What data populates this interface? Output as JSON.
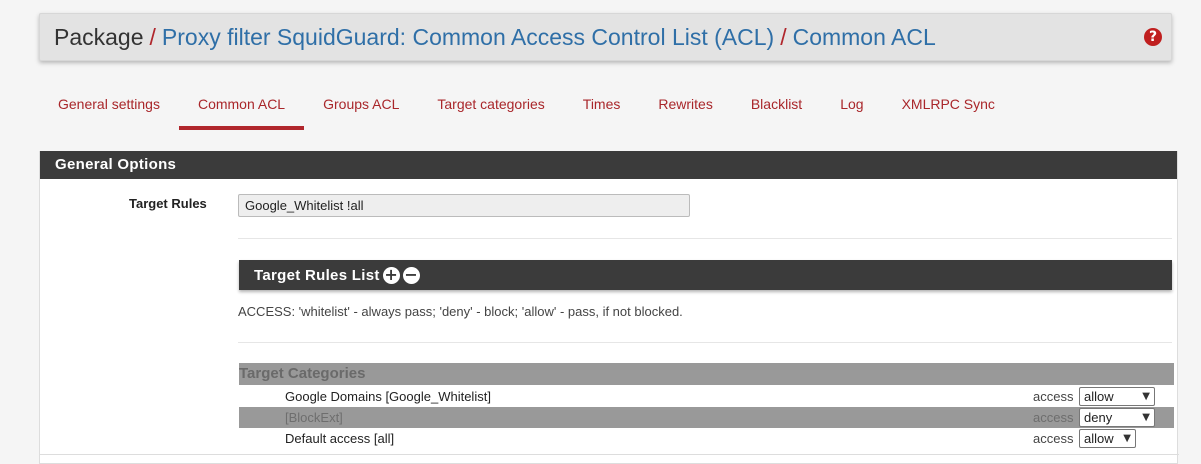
{
  "breadcrumb": {
    "root": "Package",
    "sep": "/",
    "items": [
      "Proxy filter SquidGuard: Common Access Control List (ACL)",
      "Common ACL"
    ]
  },
  "help_icon": "question-circle-icon",
  "tabs": [
    {
      "label": "General settings",
      "active": false
    },
    {
      "label": "Common ACL",
      "active": true
    },
    {
      "label": "Groups ACL",
      "active": false
    },
    {
      "label": "Target categories",
      "active": false
    },
    {
      "label": "Times",
      "active": false
    },
    {
      "label": "Rewrites",
      "active": false
    },
    {
      "label": "Blacklist",
      "active": false
    },
    {
      "label": "Log",
      "active": false
    },
    {
      "label": "XMLRPC Sync",
      "active": false
    }
  ],
  "panel": {
    "title": "General Options",
    "target_rules_label": "Target Rules",
    "target_rules_value": "Google_Whitelist !all",
    "rules_list_title": "Target Rules List",
    "add_icon": "plus-circle-icon",
    "remove_icon": "minus-circle-icon",
    "access_note": "ACCESS: 'whitelist' - always pass; 'deny' - block; 'allow' - pass, if not blocked.",
    "categories_title": "Target Categories",
    "categories": [
      {
        "name": "Google Domains [Google_Whitelist]",
        "access_label": "access",
        "value": "allow"
      },
      {
        "name": "[BlockExt]",
        "access_label": "access",
        "value": "deny"
      },
      {
        "name": "Default access [all]",
        "access_label": "access",
        "value": "allow"
      }
    ]
  },
  "colors": {
    "accent": "#b0262c",
    "link": "#2f6fa7",
    "panel_header": "#3b3b3b"
  }
}
